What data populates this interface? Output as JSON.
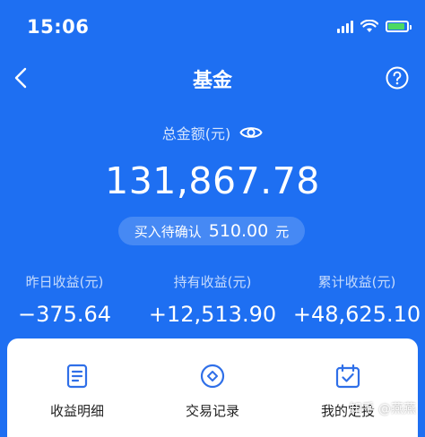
{
  "status_bar": {
    "time": "15:06"
  },
  "nav": {
    "title": "基金"
  },
  "summary": {
    "total_label": "总金额(元)",
    "total_amount": "131,867.78",
    "pending_label": "买入待确认",
    "pending_value": "510.00",
    "pending_unit": "元"
  },
  "stats": [
    {
      "label": "昨日收益(元)",
      "value": "−375.64"
    },
    {
      "label": "持有收益(元)",
      "value": "+12,513.90"
    },
    {
      "label": "累计收益(元)",
      "value": "+48,625.10"
    }
  ],
  "shortcuts": [
    {
      "label": "收益明细",
      "icon": "document-icon"
    },
    {
      "label": "交易记录",
      "icon": "diamond-icon"
    },
    {
      "label": "我的定投",
      "icon": "calendar-check-icon"
    }
  ],
  "watermark": "知乎 @燕燕",
  "colors": {
    "background": "#1E6FF2",
    "icon_blue": "#2F6FE8"
  }
}
